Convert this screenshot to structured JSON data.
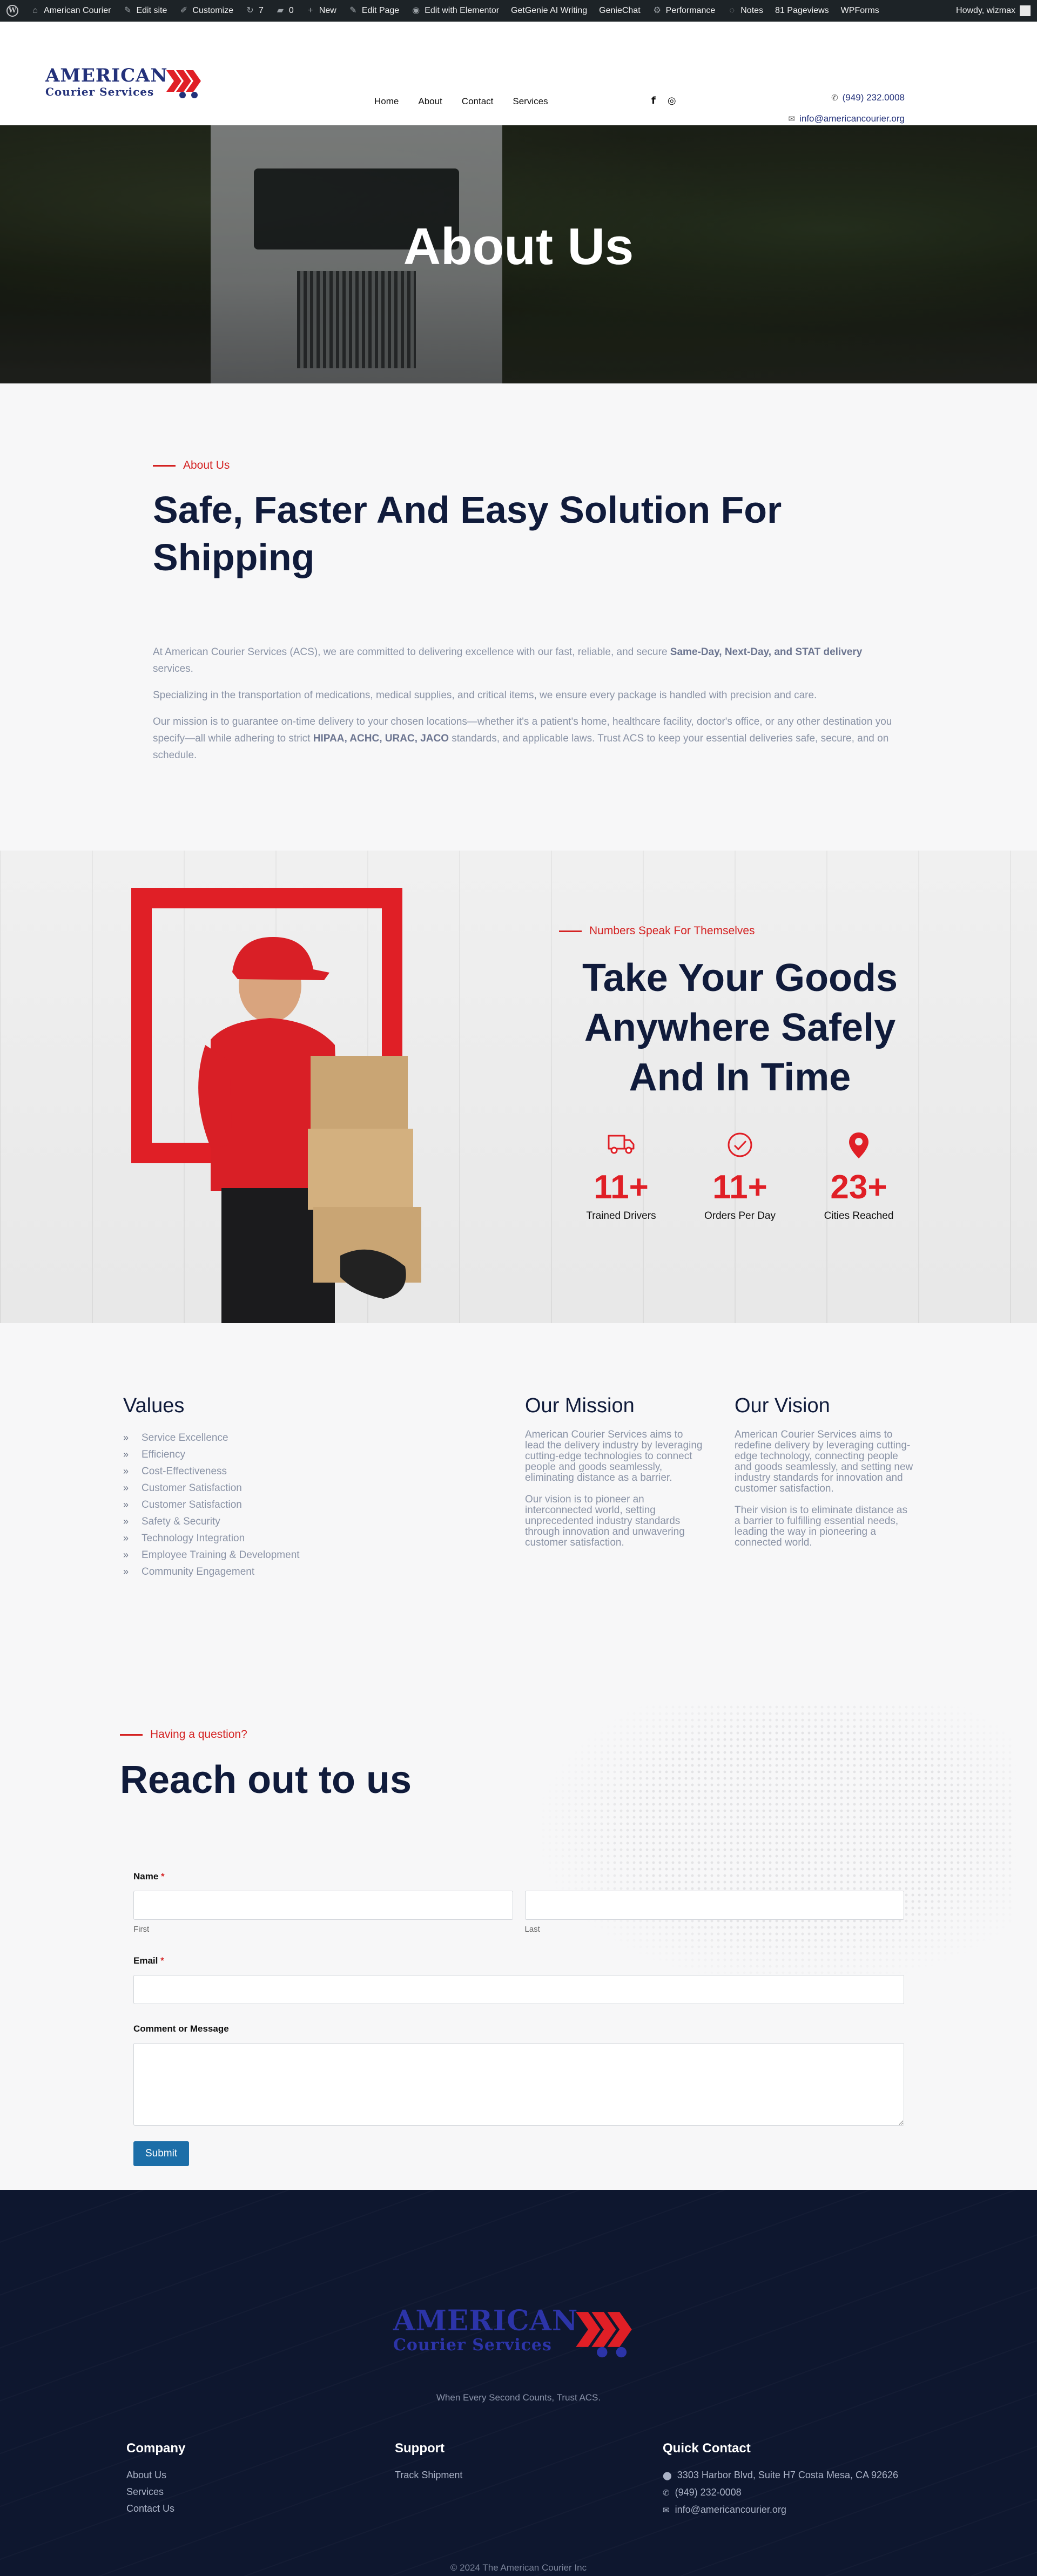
{
  "admin_bar": {
    "items": [
      {
        "icon": "wordpress-icon",
        "label": ""
      },
      {
        "icon": "home-icon",
        "label": "American Courier"
      },
      {
        "icon": "pencil-icon",
        "label": "Edit site"
      },
      {
        "icon": "brush-icon",
        "label": "Customize"
      },
      {
        "icon": "update-icon",
        "label": "7"
      },
      {
        "icon": "comment-icon",
        "label": "0"
      },
      {
        "icon": "plus-icon",
        "label": "New"
      },
      {
        "icon": "pencil-icon",
        "label": "Edit Page"
      },
      {
        "icon": "elementor-icon",
        "label": "Edit with Elementor"
      },
      {
        "icon": "",
        "label": "GetGenie AI Writing"
      },
      {
        "icon": "",
        "label": "GenieChat"
      },
      {
        "icon": "gear-icon",
        "label": "Performance"
      },
      {
        "icon": "comment-icon",
        "label": "Notes"
      },
      {
        "icon": "",
        "label": "81 Pageviews"
      },
      {
        "icon": "",
        "label": "WPForms"
      }
    ],
    "howdy": "Howdy, wizmax"
  },
  "header": {
    "logo": {
      "line1": "AMERICAN",
      "line2": "Courier Services"
    },
    "nav": [
      "Home",
      "About",
      "Contact",
      "Services"
    ],
    "phone": "(949) 232.0008",
    "email": "info@americancourier.org"
  },
  "hero": {
    "title": "About Us"
  },
  "about": {
    "kicker": "About Us",
    "heading": "Safe, Faster And Easy Solution For Shipping",
    "ghost": "Shipping",
    "p1_pre": "At American Courier Services (ACS), we are committed to delivering excellence with our fast, reliable, and secure ",
    "p1_bold": "Same-Day, Next-Day, and STAT delivery",
    "p1_post": " services.",
    "p2": "Specializing in the transportation of medications, medical supplies, and critical items, we ensure every package is handled with precision and care.",
    "p3_pre": "Our mission is to guarantee on-time delivery to your chosen locations—whether it's a patient's home, healthcare facility, doctor's office, or any other destination you specify—all while adhering to strict ",
    "p3_bold": "HIPAA, ACHC, URAC, JACO",
    "p3_post": " standards, and applicable laws. Trust ACS to keep your essential deliveries safe, secure, and on schedule."
  },
  "numbers": {
    "kicker": "Numbers Speak For Themselves",
    "heading": "Take Your Goods Anywhere Safely And In Time",
    "stats": [
      {
        "icon": "truck-icon",
        "value": "11+",
        "label": "Trained Drivers"
      },
      {
        "icon": "check-circle-icon",
        "value": "11+",
        "label": "Orders Per Day"
      },
      {
        "icon": "map-pin-icon",
        "value": "23+",
        "label": "Cities Reached"
      }
    ]
  },
  "values": {
    "title": "Values",
    "items": [
      "Service Excellence",
      "Efficiency",
      "Cost-Effectiveness",
      "Customer Satisfaction",
      "Customer Satisfaction",
      "Safety & Security",
      "Technology Integration",
      "Employee Training & Development",
      "Community Engagement"
    ],
    "mission_title": "Our Mission",
    "mission_p1": "American Courier Services aims to lead the delivery industry by leveraging cutting-edge technologies to connect people and goods seamlessly, eliminating distance as a barrier.",
    "mission_p2": "Our vision is to pioneer an interconnected world, setting unprecedented industry standards through innovation and unwavering customer satisfaction.",
    "vision_title": "Our Vision",
    "vision_p1": "American Courier Services aims to redefine delivery by leveraging cutting-edge technology, connecting people and goods seamlessly, and setting new industry standards for innovation and customer satisfaction.",
    "vision_p2": "Their vision is to eliminate distance as a barrier to fulfilling essential needs, leading the way in pioneering a connected world."
  },
  "contact": {
    "kicker": "Having a question?",
    "heading": "Reach out to us",
    "name_label": "Name",
    "first_label": "First",
    "last_label": "Last",
    "email_label": "Email",
    "message_label": "Comment or Message",
    "submit": "Submit",
    "required_mark": "*"
  },
  "footer": {
    "tagline": "When Every Second Counts, Trust ACS.",
    "company_title": "Company",
    "company_links": [
      "About Us",
      "Services",
      "Contact Us"
    ],
    "support_title": "Support",
    "support_links": [
      "Track Shipment"
    ],
    "quick_title": "Quick Contact",
    "address": "3303 Harbor Blvd, Suite H7 Costa Mesa, CA 92626",
    "phone": "(949) 232-0008",
    "email": "info@americancourier.org",
    "copyright": "© 2024 The American Courier Inc"
  },
  "colors": {
    "accent_red": "#e01f26",
    "navy": "#101b3b",
    "brand_blue": "#23317a",
    "footer_bg": "#0e172f",
    "submit_blue": "#1c6ea8"
  }
}
